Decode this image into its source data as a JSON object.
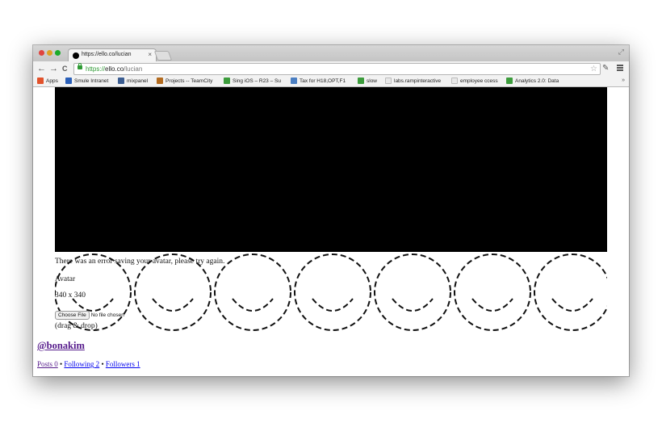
{
  "browser": {
    "tab": {
      "title": "https://ello.co/lucian",
      "close": "×"
    },
    "url": {
      "scheme": "https://",
      "host": "ello.co",
      "path": "/lucian"
    },
    "nav": {
      "back": "←",
      "forward": "→",
      "reload": "C"
    },
    "bookmarks": [
      {
        "label": "Apps",
        "icon": "apps-grid-icon",
        "color": "#e2522b"
      },
      {
        "label": "Smule Intranet",
        "icon": "smule-icon",
        "color": "#2a5fb8"
      },
      {
        "label": "mixpanel",
        "icon": "mixpanel-icon",
        "color": "#3b5d91"
      },
      {
        "label": "Projects -- TeamCity",
        "icon": "teamcity-icon",
        "color": "#b36b1f"
      },
      {
        "label": "Sing iOS – R23 – Su",
        "icon": "doc-icon",
        "color": "#3c9c3c"
      },
      {
        "label": "Tax for H18,OPT,F1",
        "icon": "tax-icon",
        "color": "#4b7fc2"
      },
      {
        "label": "slow",
        "icon": "doc-icon",
        "color": "#3c9c3c"
      },
      {
        "label": "labs.rampinteractive",
        "icon": "page-icon",
        "color": "#e8e8e8"
      },
      {
        "label": "employee ccess",
        "icon": "page-icon",
        "color": "#e8e8e8"
      },
      {
        "label": "Analytics 2.0: Data",
        "icon": "doc-icon",
        "color": "#3c9c3c"
      }
    ],
    "more": "»"
  },
  "profile": {
    "error_message": "There was an error saving your avatar, please try again.",
    "avatar_label": "Avatar",
    "avatar_size": "340 x 340",
    "file_button": "Choose File",
    "file_status": "No file chosen",
    "drag_drop": "(drag & drop)",
    "username": "@bonakim",
    "stats": {
      "posts": "Posts 0",
      "following": "Following 2",
      "followers": "Followers 1",
      "separator": "•"
    }
  }
}
